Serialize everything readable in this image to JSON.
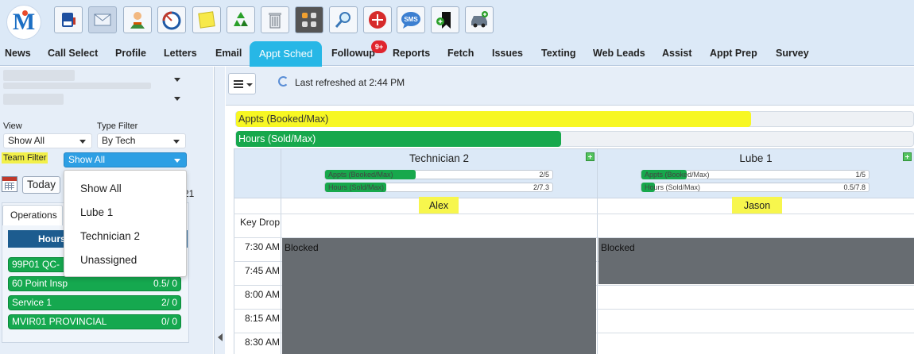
{
  "toolbar": {
    "logo_text": "M",
    "buttons": [
      "mail-box-icon",
      "envelope-icon",
      "person-icon",
      "gauge-icon",
      "sticky-note-icon",
      "recycle-icon",
      "trash-icon",
      "dots-grid-icon",
      "magnifier-icon",
      "racing-icon",
      "sms-icon",
      "bookmark-add-icon",
      "car-add-icon"
    ],
    "sms_label": "SMS"
  },
  "nav": {
    "items": [
      "News",
      "Call Select",
      "Profile",
      "Letters",
      "Email",
      "Appt Sched",
      "Followup",
      "Reports",
      "Fetch",
      "Issues",
      "Texting",
      "Web Leads",
      "Assist",
      "Appt Prep",
      "Survey"
    ],
    "active": "Appt Sched",
    "followup_badge": "9+"
  },
  "left": {
    "view_label": "View",
    "view_value": "Show All",
    "type_filter_label": "Type Filter",
    "type_filter_value": "By Tech",
    "team_filter_label": "Team Filter",
    "team_filter_value": "Show All",
    "team_options": [
      "Show All",
      "Lube 1",
      "Technician 2",
      "Unassigned"
    ],
    "today_label": "Today",
    "date_fragment": "21",
    "ops_tab": "Operations",
    "hours_label": "Hours",
    "ops": [
      {
        "name": "99P01 QC-",
        "value": ""
      },
      {
        "name": "60 Point Insp",
        "value": "0.5/ 0"
      },
      {
        "name": "Service 1",
        "value": "2/ 0"
      },
      {
        "name": "MVIR01 PROVINCIAL",
        "value": "0/ 0"
      }
    ]
  },
  "right": {
    "refresh_text": "Last refreshed at 2:44 PM",
    "appts_bar": {
      "label": "Appts (Booked/Max)",
      "fill": 0.76
    },
    "hours_bar": {
      "label": "Hours (Sold/Max)",
      "fill": 0.48
    },
    "columns": [
      {
        "title": "Technician 2",
        "tech_name": "Alex",
        "appts_label": "Appts (Booked/Max)",
        "appts_value": "2/5",
        "appts_fill": 0.4,
        "hours_label": "Hours (Sold/Max)",
        "hours_value": "2/7.3",
        "hours_fill": 0.27
      },
      {
        "title": "Lube 1",
        "tech_name": "Jason",
        "appts_label": "Appts (Booked/Max)",
        "appts_value": "1/5",
        "appts_fill": 0.2,
        "hours_label": "Hours (Sold/Max)",
        "hours_value": "0.5/7.8",
        "hours_fill": 0.06
      }
    ],
    "key_drop_label": "Key Drop",
    "times": [
      "7:30 AM",
      "7:45 AM",
      "8:00 AM",
      "8:15 AM",
      "8:30 AM"
    ],
    "blocked_label": "Blocked"
  },
  "colors": {
    "accent_tab": "#27b7e6",
    "progress_green": "#17a84c",
    "highlight_yellow": "#f7f723",
    "blocked_gray": "#676c71",
    "badge_red": "#e0252e"
  }
}
